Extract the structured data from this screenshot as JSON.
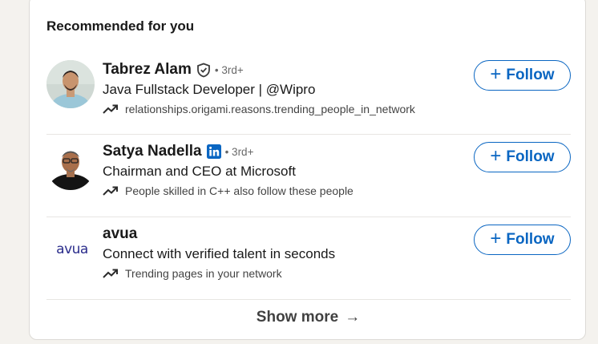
{
  "section": {
    "title": "Recommended for you"
  },
  "recommendations": [
    {
      "name": "Tabrez Alam",
      "badge_icon": "verified-shield-icon",
      "degree": "• 3rd+",
      "headline": "Java Fullstack Developer | @Wipro",
      "reason": "relationships.origami.reasons.trending_people_in_network",
      "follow_label": "Follow"
    },
    {
      "name": "Satya Nadella",
      "badge_icon": "linkedin-icon",
      "degree": "• 3rd+",
      "headline": "Chairman and CEO at Microsoft",
      "reason": "People skilled in C++ also follow these people",
      "follow_label": "Follow"
    },
    {
      "name": "avua",
      "logo_text": "avua",
      "headline": "Connect with verified talent in seconds",
      "reason": "Trending pages in your network",
      "follow_label": "Follow"
    }
  ],
  "footer": {
    "show_more_label": "Show more",
    "arrow": "→"
  },
  "colors": {
    "accent": "#0a66c2",
    "background": "#f4f2ee",
    "card": "#ffffff"
  }
}
